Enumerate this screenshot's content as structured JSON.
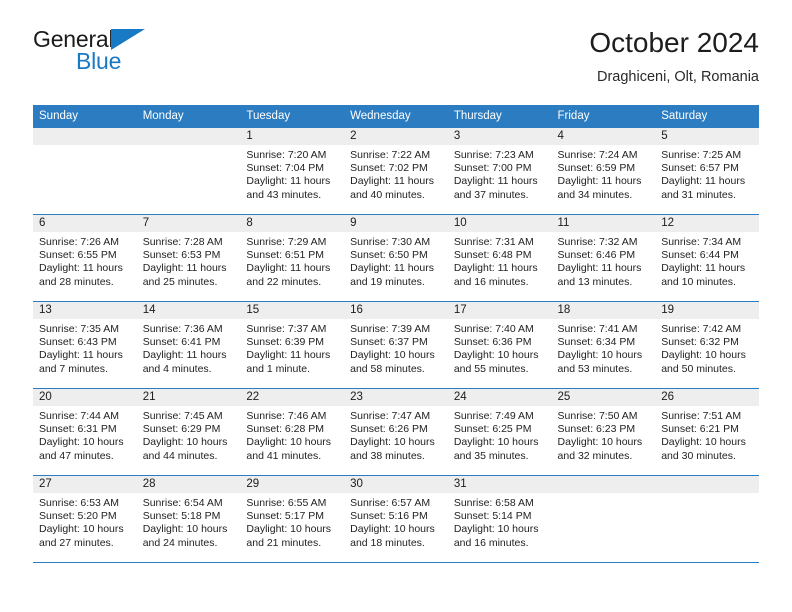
{
  "brand": {
    "word_general": "General",
    "word_blue": "Blue",
    "triangle_color": "#1879c4"
  },
  "header": {
    "title": "October 2024",
    "subtitle": "Draghiceni, Olt, Romania"
  },
  "theme": {
    "header_blue": "#2b7cc0",
    "band_gray": "#eeeeee",
    "text_dark": "#1c1c1c"
  },
  "calendar": {
    "weekday_headers": [
      "Sunday",
      "Monday",
      "Tuesday",
      "Wednesday",
      "Thursday",
      "Friday",
      "Saturday"
    ],
    "weeks": [
      [
        {
          "day": "",
          "sunrise": "",
          "sunset": "",
          "daylight1": "",
          "daylight2": "",
          "blank": true
        },
        {
          "day": "",
          "sunrise": "",
          "sunset": "",
          "daylight1": "",
          "daylight2": "",
          "blank": true
        },
        {
          "day": "1",
          "sunrise": "Sunrise: 7:20 AM",
          "sunset": "Sunset: 7:04 PM",
          "daylight1": "Daylight: 11 hours",
          "daylight2": "and 43 minutes."
        },
        {
          "day": "2",
          "sunrise": "Sunrise: 7:22 AM",
          "sunset": "Sunset: 7:02 PM",
          "daylight1": "Daylight: 11 hours",
          "daylight2": "and 40 minutes."
        },
        {
          "day": "3",
          "sunrise": "Sunrise: 7:23 AM",
          "sunset": "Sunset: 7:00 PM",
          "daylight1": "Daylight: 11 hours",
          "daylight2": "and 37 minutes."
        },
        {
          "day": "4",
          "sunrise": "Sunrise: 7:24 AM",
          "sunset": "Sunset: 6:59 PM",
          "daylight1": "Daylight: 11 hours",
          "daylight2": "and 34 minutes."
        },
        {
          "day": "5",
          "sunrise": "Sunrise: 7:25 AM",
          "sunset": "Sunset: 6:57 PM",
          "daylight1": "Daylight: 11 hours",
          "daylight2": "and 31 minutes."
        }
      ],
      [
        {
          "day": "6",
          "sunrise": "Sunrise: 7:26 AM",
          "sunset": "Sunset: 6:55 PM",
          "daylight1": "Daylight: 11 hours",
          "daylight2": "and 28 minutes."
        },
        {
          "day": "7",
          "sunrise": "Sunrise: 7:28 AM",
          "sunset": "Sunset: 6:53 PM",
          "daylight1": "Daylight: 11 hours",
          "daylight2": "and 25 minutes."
        },
        {
          "day": "8",
          "sunrise": "Sunrise: 7:29 AM",
          "sunset": "Sunset: 6:51 PM",
          "daylight1": "Daylight: 11 hours",
          "daylight2": "and 22 minutes."
        },
        {
          "day": "9",
          "sunrise": "Sunrise: 7:30 AM",
          "sunset": "Sunset: 6:50 PM",
          "daylight1": "Daylight: 11 hours",
          "daylight2": "and 19 minutes."
        },
        {
          "day": "10",
          "sunrise": "Sunrise: 7:31 AM",
          "sunset": "Sunset: 6:48 PM",
          "daylight1": "Daylight: 11 hours",
          "daylight2": "and 16 minutes."
        },
        {
          "day": "11",
          "sunrise": "Sunrise: 7:32 AM",
          "sunset": "Sunset: 6:46 PM",
          "daylight1": "Daylight: 11 hours",
          "daylight2": "and 13 minutes."
        },
        {
          "day": "12",
          "sunrise": "Sunrise: 7:34 AM",
          "sunset": "Sunset: 6:44 PM",
          "daylight1": "Daylight: 11 hours",
          "daylight2": "and 10 minutes."
        }
      ],
      [
        {
          "day": "13",
          "sunrise": "Sunrise: 7:35 AM",
          "sunset": "Sunset: 6:43 PM",
          "daylight1": "Daylight: 11 hours",
          "daylight2": "and 7 minutes."
        },
        {
          "day": "14",
          "sunrise": "Sunrise: 7:36 AM",
          "sunset": "Sunset: 6:41 PM",
          "daylight1": "Daylight: 11 hours",
          "daylight2": "and 4 minutes."
        },
        {
          "day": "15",
          "sunrise": "Sunrise: 7:37 AM",
          "sunset": "Sunset: 6:39 PM",
          "daylight1": "Daylight: 11 hours",
          "daylight2": "and 1 minute."
        },
        {
          "day": "16",
          "sunrise": "Sunrise: 7:39 AM",
          "sunset": "Sunset: 6:37 PM",
          "daylight1": "Daylight: 10 hours",
          "daylight2": "and 58 minutes."
        },
        {
          "day": "17",
          "sunrise": "Sunrise: 7:40 AM",
          "sunset": "Sunset: 6:36 PM",
          "daylight1": "Daylight: 10 hours",
          "daylight2": "and 55 minutes."
        },
        {
          "day": "18",
          "sunrise": "Sunrise: 7:41 AM",
          "sunset": "Sunset: 6:34 PM",
          "daylight1": "Daylight: 10 hours",
          "daylight2": "and 53 minutes."
        },
        {
          "day": "19",
          "sunrise": "Sunrise: 7:42 AM",
          "sunset": "Sunset: 6:32 PM",
          "daylight1": "Daylight: 10 hours",
          "daylight2": "and 50 minutes."
        }
      ],
      [
        {
          "day": "20",
          "sunrise": "Sunrise: 7:44 AM",
          "sunset": "Sunset: 6:31 PM",
          "daylight1": "Daylight: 10 hours",
          "daylight2": "and 47 minutes."
        },
        {
          "day": "21",
          "sunrise": "Sunrise: 7:45 AM",
          "sunset": "Sunset: 6:29 PM",
          "daylight1": "Daylight: 10 hours",
          "daylight2": "and 44 minutes."
        },
        {
          "day": "22",
          "sunrise": "Sunrise: 7:46 AM",
          "sunset": "Sunset: 6:28 PM",
          "daylight1": "Daylight: 10 hours",
          "daylight2": "and 41 minutes."
        },
        {
          "day": "23",
          "sunrise": "Sunrise: 7:47 AM",
          "sunset": "Sunset: 6:26 PM",
          "daylight1": "Daylight: 10 hours",
          "daylight2": "and 38 minutes."
        },
        {
          "day": "24",
          "sunrise": "Sunrise: 7:49 AM",
          "sunset": "Sunset: 6:25 PM",
          "daylight1": "Daylight: 10 hours",
          "daylight2": "and 35 minutes."
        },
        {
          "day": "25",
          "sunrise": "Sunrise: 7:50 AM",
          "sunset": "Sunset: 6:23 PM",
          "daylight1": "Daylight: 10 hours",
          "daylight2": "and 32 minutes."
        },
        {
          "day": "26",
          "sunrise": "Sunrise: 7:51 AM",
          "sunset": "Sunset: 6:21 PM",
          "daylight1": "Daylight: 10 hours",
          "daylight2": "and 30 minutes."
        }
      ],
      [
        {
          "day": "27",
          "sunrise": "Sunrise: 6:53 AM",
          "sunset": "Sunset: 5:20 PM",
          "daylight1": "Daylight: 10 hours",
          "daylight2": "and 27 minutes."
        },
        {
          "day": "28",
          "sunrise": "Sunrise: 6:54 AM",
          "sunset": "Sunset: 5:18 PM",
          "daylight1": "Daylight: 10 hours",
          "daylight2": "and 24 minutes."
        },
        {
          "day": "29",
          "sunrise": "Sunrise: 6:55 AM",
          "sunset": "Sunset: 5:17 PM",
          "daylight1": "Daylight: 10 hours",
          "daylight2": "and 21 minutes."
        },
        {
          "day": "30",
          "sunrise": "Sunrise: 6:57 AM",
          "sunset": "Sunset: 5:16 PM",
          "daylight1": "Daylight: 10 hours",
          "daylight2": "and 18 minutes."
        },
        {
          "day": "31",
          "sunrise": "Sunrise: 6:58 AM",
          "sunset": "Sunset: 5:14 PM",
          "daylight1": "Daylight: 10 hours",
          "daylight2": "and 16 minutes."
        },
        {
          "day": "",
          "sunrise": "",
          "sunset": "",
          "daylight1": "",
          "daylight2": "",
          "blank": true
        },
        {
          "day": "",
          "sunrise": "",
          "sunset": "",
          "daylight1": "",
          "daylight2": "",
          "blank": true
        }
      ]
    ]
  }
}
